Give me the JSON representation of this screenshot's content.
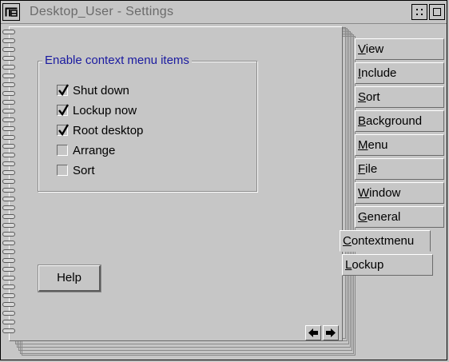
{
  "window": {
    "title": "Desktop_User - Settings"
  },
  "group": {
    "label": "Enable context menu items"
  },
  "checkboxes": [
    {
      "label": "Shut down",
      "checked": true
    },
    {
      "label": "Lockup now",
      "checked": true
    },
    {
      "label": "Root desktop",
      "checked": true
    },
    {
      "label": "Arrange",
      "checked": false
    },
    {
      "label": "Sort",
      "checked": false
    }
  ],
  "help_button": {
    "label": "Help"
  },
  "tabs": [
    {
      "first": "V",
      "rest": "iew"
    },
    {
      "first": "I",
      "rest": "nclude"
    },
    {
      "first": "S",
      "rest": "ort"
    },
    {
      "first": "B",
      "rest": "ackground"
    },
    {
      "first": "M",
      "rest": "enu"
    },
    {
      "first": "F",
      "rest": "ile"
    },
    {
      "first": "W",
      "rest": "indow"
    },
    {
      "first": "G",
      "rest": "eneral"
    },
    {
      "first": "C",
      "rest": "ontextmenu"
    },
    {
      "first": "L",
      "rest": "ockup"
    }
  ],
  "active_tab": "Contextmenu",
  "icons": {
    "system_menu": "system-menu-icon",
    "minimize": "minimize-icon",
    "maximize": "maximize-icon",
    "prev_page": "left-arrow-icon",
    "next_page": "right-arrow-icon"
  }
}
